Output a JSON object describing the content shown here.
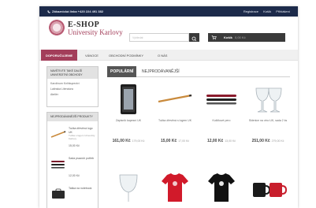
{
  "topbar": {
    "phone": "Zákaznická linka +420 224 491 382",
    "links": [
      "Registrace",
      "Košík",
      "Přihlášení"
    ]
  },
  "header": {
    "brand_line1": "E-SHOP",
    "brand_line2": "University Karlovy",
    "search_placeholder": "Vyhledat",
    "cart_label": "Košík",
    "cart_value": "0,00 Kč"
  },
  "nav": {
    "items": [
      {
        "label": "Doporučujeme",
        "active": true
      },
      {
        "label": "Vánoce",
        "active": false
      },
      {
        "label": "Obchodní podmínky",
        "active": false
      },
      {
        "label": "O nás",
        "active": false
      }
    ]
  },
  "sidebar": {
    "promo": {
      "heading": "Navštivte také další univerzitní obchody",
      "links": [
        "Karolinum Knihkupectví",
        "Latinská Literatura",
        "Ateliér"
      ]
    },
    "bestsellers": {
      "heading": "Nejprodávanější produkty",
      "items": [
        {
          "name": "Tužka dřevěná logo UK",
          "desc": "Tužka s logem Univerzity Karlovy",
          "price": "15,00 Kč"
        },
        {
          "name": "Sada psacích potřeb",
          "desc": "",
          "price": "12,00 Kč"
        },
        {
          "name": "Taška na notebook",
          "desc": "",
          "price": ""
        }
      ]
    }
  },
  "tabs": {
    "active": "Populární",
    "inactive": "Nejprodávanější"
  },
  "products": [
    {
      "name": "Zápisník kapesní UK",
      "price": "161,00 Kč",
      "old_price": "179,00 Kč",
      "icon": "notebook-icon"
    },
    {
      "name": "Tužka dřevěná s logem UK",
      "price": "15,00 Kč",
      "old_price": "17,00 Kč",
      "icon": "pencil-icon"
    },
    {
      "name": "Kuličkové pero",
      "price": "12,00 Kč",
      "old_price": "13,00 Kč",
      "icon": "pens-icon"
    },
    {
      "name": "Sklenice na víno UK, sada 2 ks",
      "price": "251,00 Kč",
      "old_price": "279,00 Kč",
      "icon": "wine-glasses-icon"
    },
    {
      "name": "Sklenice na vodu",
      "price": "",
      "old_price": "",
      "icon": "glass-icon"
    },
    {
      "name": "Tričko červené",
      "price": "",
      "old_price": "",
      "icon": "tshirt-red-icon"
    },
    {
      "name": "Tričko černé",
      "price": "",
      "old_price": "",
      "icon": "tshirt-black-icon"
    },
    {
      "name": "Hrnky",
      "price": "",
      "old_price": "",
      "icon": "mugs-icon"
    }
  ],
  "colors": {
    "topbar": "#1c2a4a",
    "accent": "#a33e5a",
    "cart": "#3a3a3a",
    "tab_active": "#555555"
  }
}
